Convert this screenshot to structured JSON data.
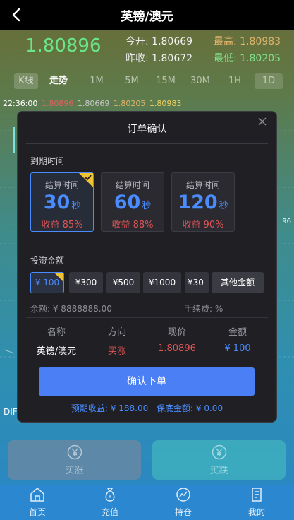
{
  "header": {
    "title": "英镑/澳元",
    "back_icon": "chevron-left-icon"
  },
  "quote": {
    "price": "1.80896",
    "open_label": "今开:",
    "open_value": "1.80669",
    "prev_close_label": "昨收:",
    "prev_close_value": "1.80672",
    "high_label": "最高:",
    "high_value": "1.80983",
    "low_label": "最低:",
    "low_value": "1.80205"
  },
  "tabs": [
    "K线",
    "走势",
    "1M",
    "5M",
    "15M",
    "30M",
    "1H",
    "1D"
  ],
  "ohlc": {
    "time": "22:36:00",
    "v1": "1.80896",
    "v2": "1.80669",
    "v3": "1.80205",
    "v4": "1.80983"
  },
  "chart_side": {
    "left_label": "DIF",
    "right_label": "96"
  },
  "modal": {
    "title": "订单确认",
    "expiry_label": "到期时间",
    "expiry_options": [
      {
        "label": "结算时间",
        "seconds": "30",
        "unit": "秒",
        "yield": "收益 85%"
      },
      {
        "label": "结算时间",
        "seconds": "60",
        "unit": "秒",
        "yield": "收益 88%"
      },
      {
        "label": "结算时间",
        "seconds": "120",
        "unit": "秒",
        "yield": "收益 90%"
      }
    ],
    "amount_label": "投资金额",
    "amounts": [
      "¥ 100",
      "¥300",
      "¥500",
      "¥1000",
      "¥30"
    ],
    "other_amount": "其他金额",
    "balance": "余额: ¥ 8888888.00",
    "fee": "手续费: %",
    "columns": [
      "名称",
      "方向",
      "现价",
      "金额"
    ],
    "order": {
      "name": "英镑/澳元",
      "direction": "买涨",
      "price": "1.80896",
      "amount": "¥ 100"
    },
    "confirm": "确认下单",
    "expected_profit": "预期收益: ¥ 188.00",
    "guarantee": "保底金额: ¥ 0.00"
  },
  "actions": {
    "buy_up": "买涨",
    "buy_down": "买跌"
  },
  "nav": [
    "首页",
    "充值",
    "持仓",
    "我的"
  ],
  "colors": {
    "accent": "#4a8cff",
    "up": "#e05555",
    "price": "#6be58a",
    "check": "#f1c232"
  }
}
